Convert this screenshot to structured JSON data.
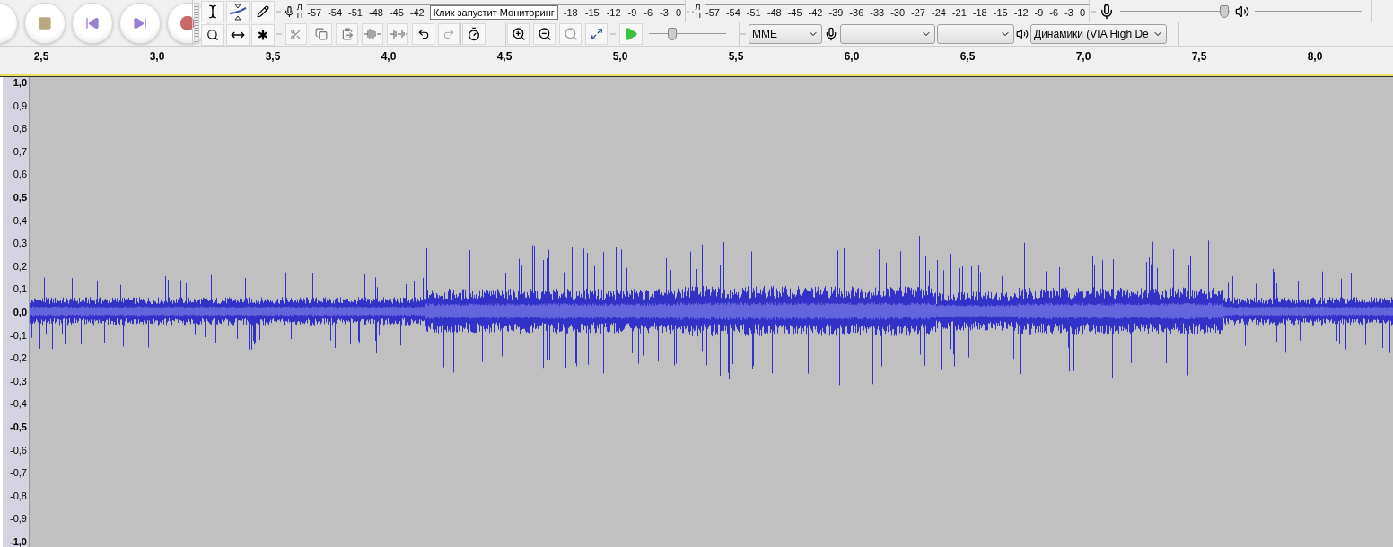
{
  "record_meter": {
    "channel_labels": [
      "Л",
      "П"
    ],
    "ticks_before": [
      "-57",
      "-54",
      "-51",
      "-48",
      "-45",
      "-42"
    ],
    "ticks_after": [
      "-18",
      "-15",
      "-12",
      "-9",
      "-6",
      "-3",
      "0"
    ]
  },
  "tooltip": "Клик запустит Мониторинг",
  "playback_meter": {
    "channel_labels": [
      "Л",
      "П"
    ],
    "ticks": [
      "-57",
      "-54",
      "-51",
      "-48",
      "-45",
      "-42",
      "-39",
      "-36",
      "-33",
      "-30",
      "-27",
      "-24",
      "-21",
      "-18",
      "-15",
      "-12",
      "-9",
      "-6",
      "-3",
      "0"
    ]
  },
  "mixer": {
    "recording_volume": {
      "level": 0.95
    }
  },
  "play_at_speed": {
    "level": 0.3
  },
  "device": {
    "host": "MME",
    "output_device": "Динамики (VIA High De"
  },
  "ruler": {
    "labels": [
      "2,5",
      "3,0",
      "3,5",
      "4,0",
      "4,5",
      "5,0",
      "5,5",
      "6,0",
      "6,5",
      "7,0",
      "7,5",
      "8,0"
    ]
  },
  "track": {
    "scale": [
      {
        "label": "1,0",
        "bold": true
      },
      {
        "label": "0,9",
        "bold": false
      },
      {
        "label": "0,8",
        "bold": false
      },
      {
        "label": "0,7",
        "bold": false
      },
      {
        "label": "0,6",
        "bold": false
      },
      {
        "label": "0,5",
        "bold": true
      },
      {
        "label": "0,4",
        "bold": false
      },
      {
        "label": "0,3",
        "bold": false
      },
      {
        "label": "0,2",
        "bold": false
      },
      {
        "label": "0,1",
        "bold": false
      },
      {
        "label": "0,0",
        "bold": true
      },
      {
        "label": "-0,1",
        "bold": false
      },
      {
        "label": "-0,2",
        "bold": false
      },
      {
        "label": "-0,3",
        "bold": false
      },
      {
        "label": "-0,4",
        "bold": false
      },
      {
        "label": "-0,5",
        "bold": true
      },
      {
        "label": "-0,6",
        "bold": false
      },
      {
        "label": "-0,7",
        "bold": false
      },
      {
        "label": "-0,8",
        "bold": false
      },
      {
        "label": "-0,9",
        "bold": false
      },
      {
        "label": "-1,0",
        "bold": true
      }
    ]
  }
}
